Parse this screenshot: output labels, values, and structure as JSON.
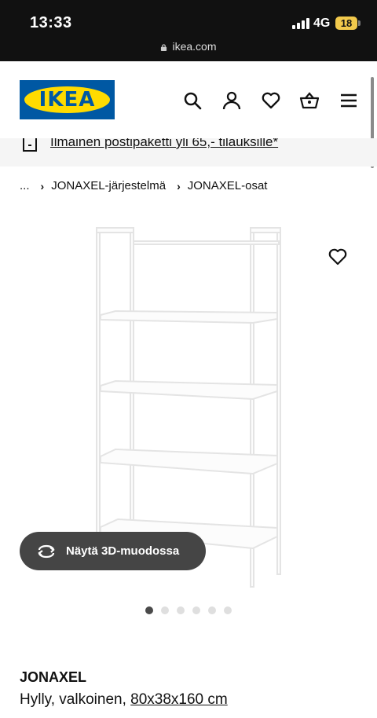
{
  "status_bar": {
    "time": "13:33",
    "network": "4G",
    "battery": "18",
    "url": "ikea.com"
  },
  "header": {
    "logo_text": "IKEA",
    "icons": [
      "search-icon",
      "account-icon",
      "heart-icon",
      "basket-icon",
      "menu-icon"
    ]
  },
  "promo": {
    "text": "Ilmainen postipaketti yli 65,- tilauksille*"
  },
  "breadcrumb": {
    "first": "...",
    "items": [
      "JONAXEL-järjestelmä",
      "JONAXEL-osat"
    ]
  },
  "gallery": {
    "view_3d_label": "Näytä 3D-muodossa",
    "dot_count": 6,
    "active_dot": 0
  },
  "product": {
    "name": "JONAXEL",
    "description_prefix": "Hylly, valkoinen,",
    "size": "80x38x160 cm"
  },
  "colors": {
    "status_bar_bg": "#111111",
    "ikea_blue": "#0058a3",
    "ikea_yellow": "#ffdb00",
    "pill_bg": "#454545"
  }
}
